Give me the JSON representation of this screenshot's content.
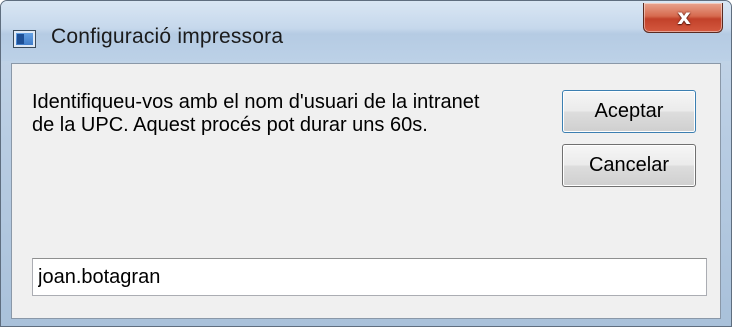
{
  "window": {
    "title": "Configuració impressora",
    "icon": "printer-setup-icon",
    "close_glyph": "x"
  },
  "dialog": {
    "message_line1": "Identifiqueu-vos amb el nom d'usuari de la intranet",
    "message_line2": "de la UPC. Aquest procés pot durar uns 60s.",
    "accept_label": "Aceptar",
    "cancel_label": "Cancelar",
    "username_value": "joan.botagran"
  },
  "colors": {
    "titlebar": "#c6d8ec",
    "close_button": "#c2412a",
    "client_background": "#f0f0f0",
    "default_button_border": "#3c7fb1"
  }
}
